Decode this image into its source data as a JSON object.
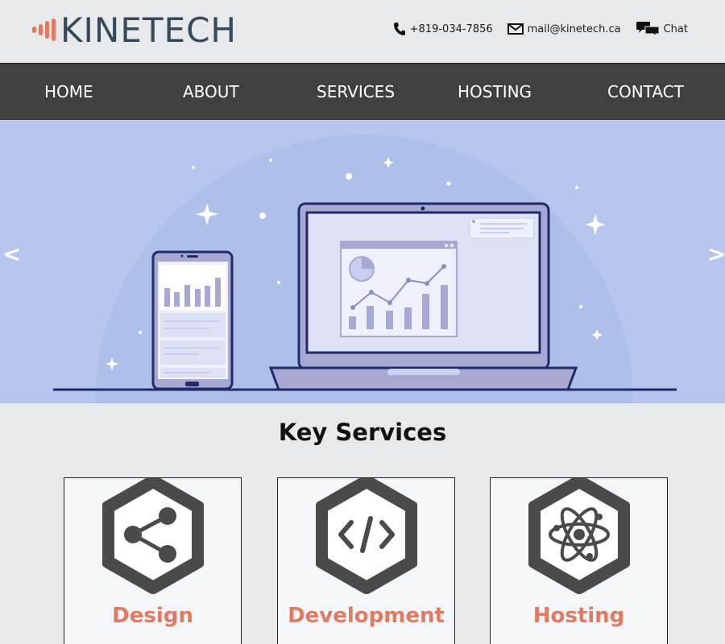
{
  "brand": {
    "name": "KINETECH",
    "accent": "#e07b63",
    "text_color": "#34495a"
  },
  "contacts": {
    "phone": {
      "icon": "phone-icon",
      "label": "+819-034-7856"
    },
    "email": {
      "icon": "mail-icon",
      "label": "mail@kinetech.ca"
    },
    "chat": {
      "icon": "chat-bubbles-icon",
      "label": "Chat"
    }
  },
  "nav": {
    "background": "#404040",
    "items": [
      {
        "label": "HOME"
      },
      {
        "label": "ABOUT"
      },
      {
        "label": "SERVICES"
      },
      {
        "label": "HOSTING"
      },
      {
        "label": "CONTACT"
      }
    ]
  },
  "hero": {
    "background": "#b6c6ef",
    "prev_label": "<",
    "next_label": ">"
  },
  "services": {
    "title": "Key Services",
    "cards": [
      {
        "label": "Design",
        "icon": "share-icon"
      },
      {
        "label": "Development",
        "icon": "code-icon"
      },
      {
        "label": "Hosting",
        "icon": "atom-icon"
      }
    ]
  }
}
